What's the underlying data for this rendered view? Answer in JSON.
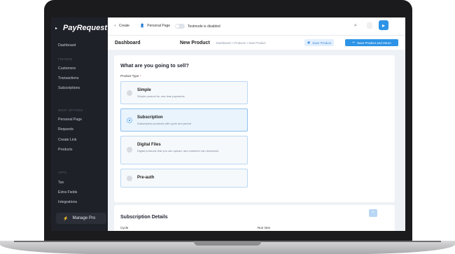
{
  "sidebar": {
    "logo": "PayRequest",
    "items_general": [
      "Dashboard"
    ],
    "section_finance": "FINANCE",
    "items_finance": [
      "Customers",
      "Transactions",
      "Subscriptions"
    ],
    "section_get_paid": "MOST OPTIONS",
    "items_get_paid": [
      "Personal Page",
      "Requests",
      "Create Link",
      "Products"
    ],
    "section_apps": "APPS",
    "items_apps": [
      "Tax",
      "Extra Fields",
      "Integrations"
    ],
    "manage_label": "Manage Pro"
  },
  "topbar": {
    "create": "Create",
    "personal_page": "Personal Page",
    "testmode": "Testmode is disabled"
  },
  "header": {
    "dashboard": "Dashboard",
    "title": "New Product",
    "breadcrumb": "Dashboard > Products > New Product",
    "save_label": "Save Product",
    "save_return_label": "Save Product and return"
  },
  "product_form": {
    "question": "What are you going to sell?",
    "product_type_label": "Product Type",
    "required_mark": "*",
    "options": [
      {
        "title": "Simple",
        "desc": "Simple product for one-time payments"
      },
      {
        "title": "Subscription",
        "desc": "Subscription products with cycle and period"
      },
      {
        "title": "Digital Files",
        "desc": "Digital products that you can upload, and customer can download"
      },
      {
        "title": "Pre-auth",
        "desc": ""
      }
    ],
    "selected": "Subscription"
  },
  "subscription": {
    "title": "Subscription Details",
    "cycle_label": "Cycle",
    "runtime_label": "Run time"
  },
  "colors": {
    "accent": "#2d93e6",
    "sidebar_bg": "#1f2129"
  }
}
